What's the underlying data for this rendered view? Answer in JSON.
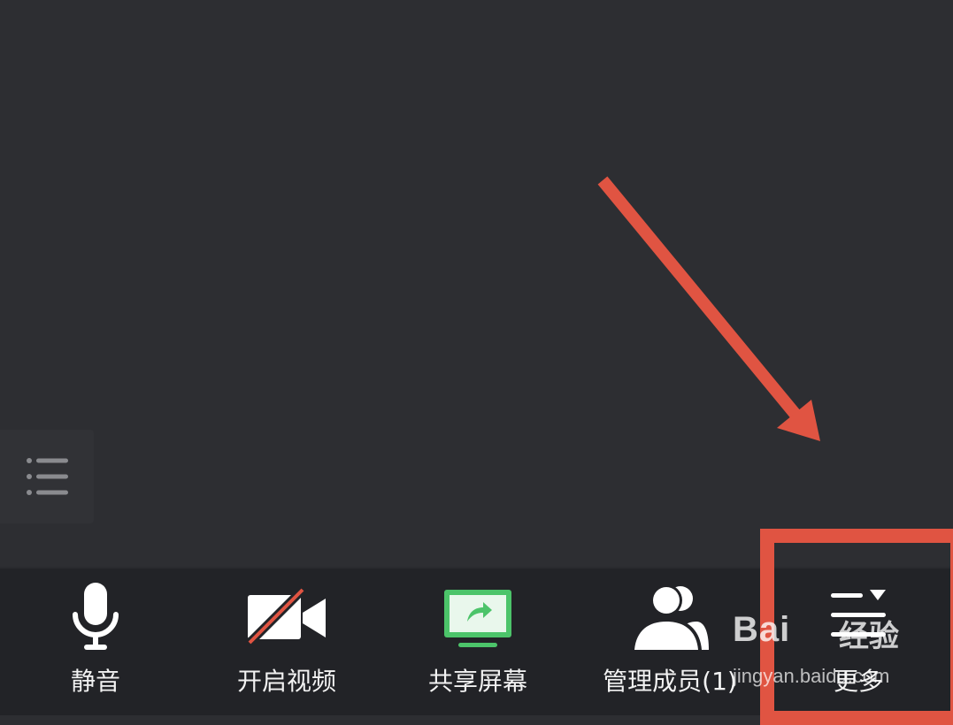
{
  "toolbar": {
    "mute": {
      "label": "静音",
      "icon": "microphone-icon"
    },
    "video": {
      "label": "开启视频",
      "icon": "video-camera-off-icon"
    },
    "share": {
      "label": "共享屏幕",
      "icon": "share-screen-icon"
    },
    "members": {
      "label": "管理成员(1)",
      "icon": "members-icon"
    },
    "more": {
      "label": "更多",
      "icon": "more-menu-icon"
    }
  },
  "side_panel": {
    "icon": "list-icon"
  },
  "annotation": {
    "color": "#e05442"
  },
  "watermark": {
    "brand": "Bai",
    "brand_cn": "经验",
    "url": "jingyan.baidu.com"
  },
  "colors": {
    "background": "#2d2e32",
    "toolbar": "#222327",
    "share_accent": "#4cc46a"
  }
}
